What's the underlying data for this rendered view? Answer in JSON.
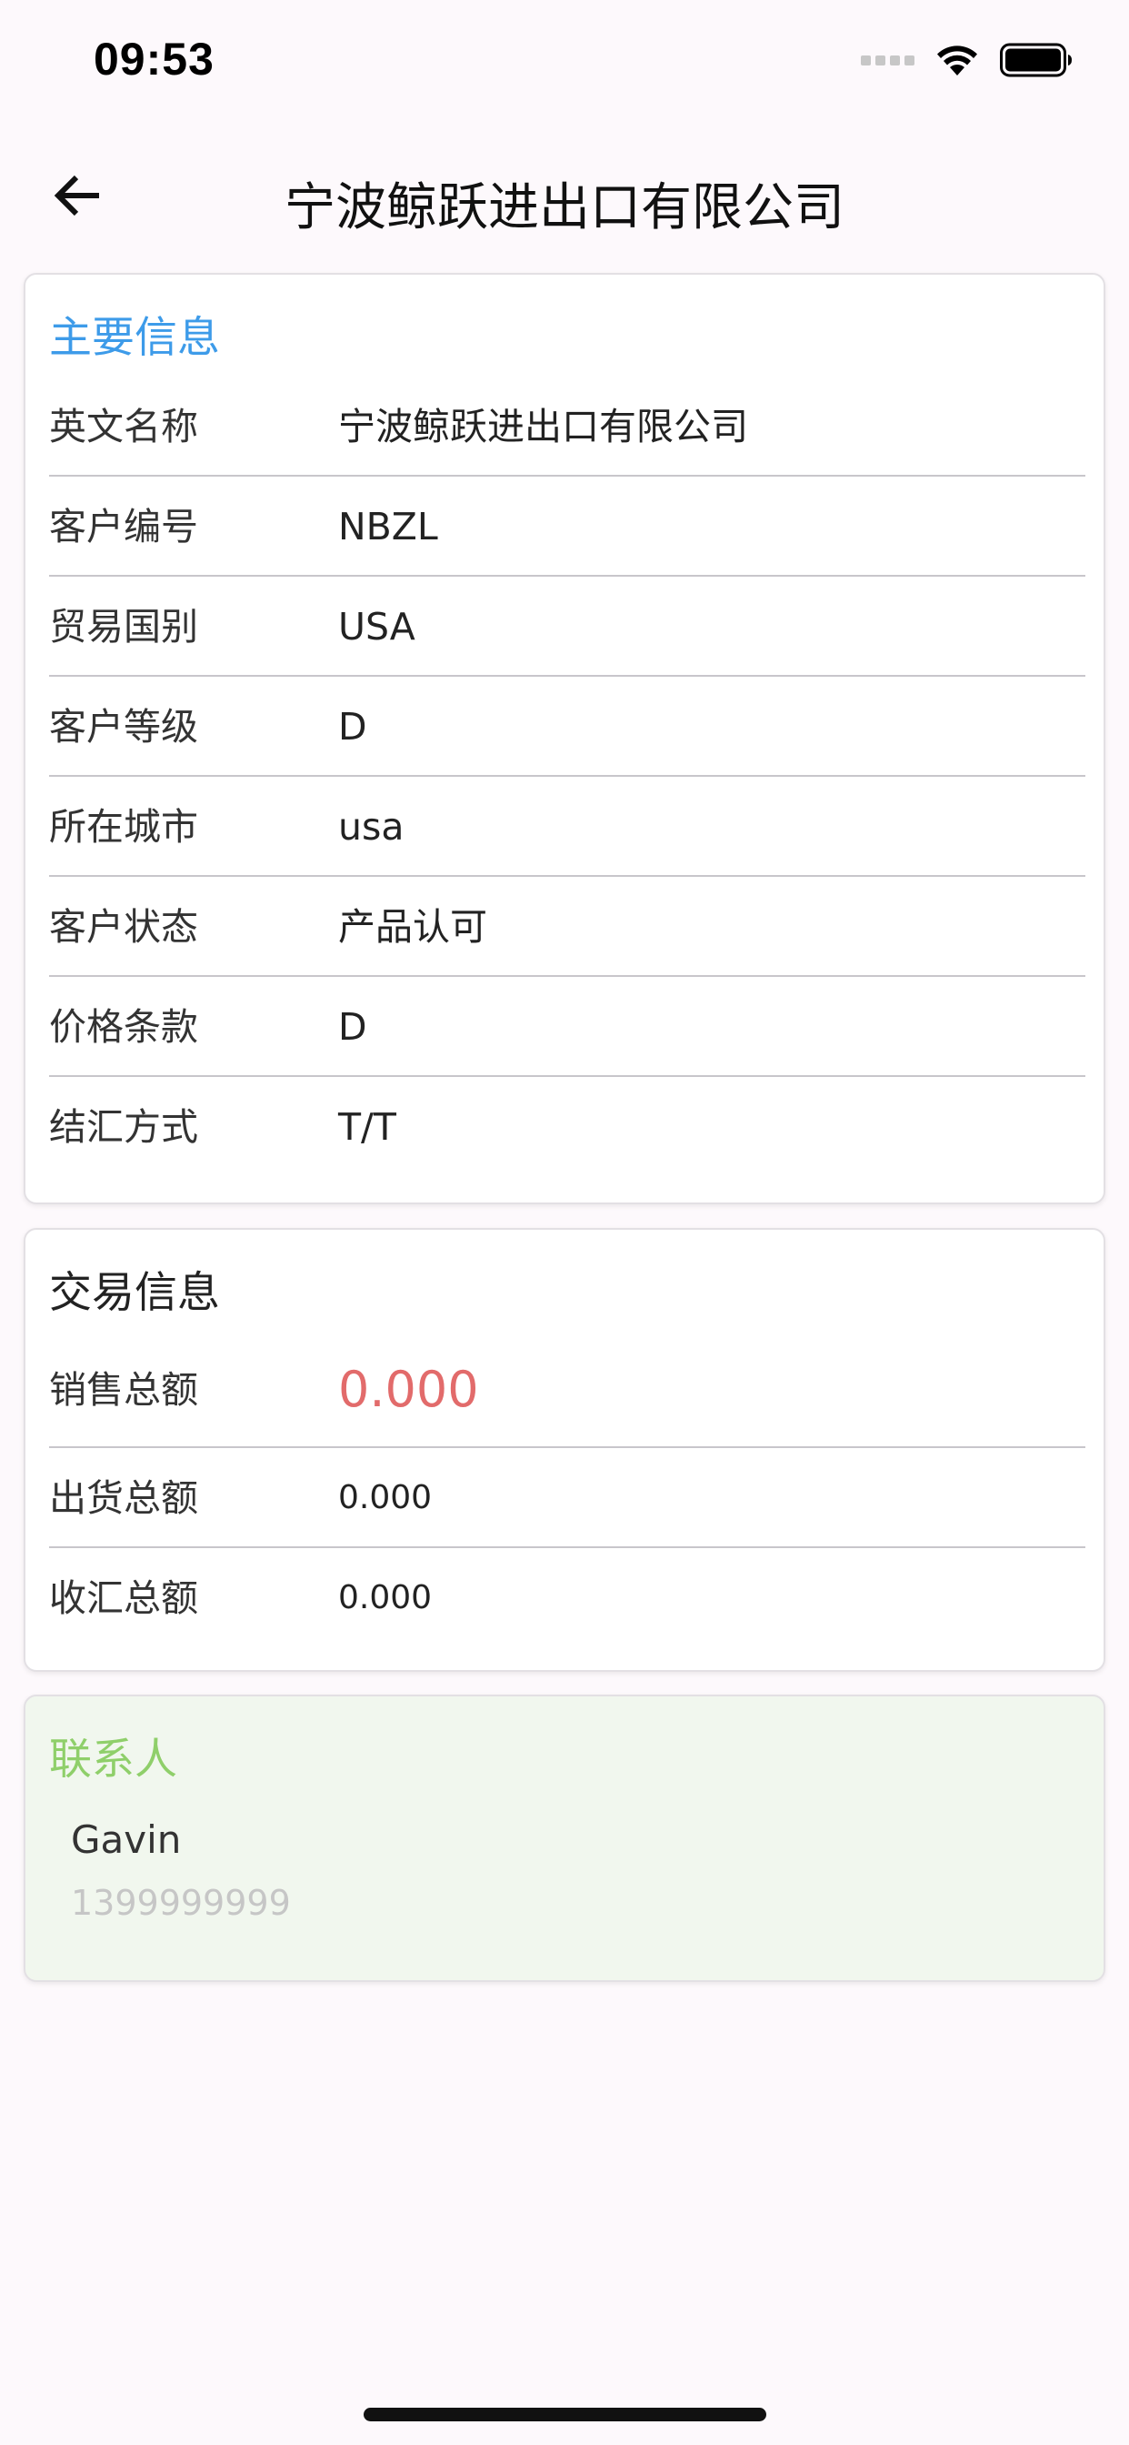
{
  "status_bar": {
    "time": "09:53"
  },
  "header": {
    "title": "宁波鲸跃进出口有限公司",
    "back_icon": "arrow-left-icon"
  },
  "main_info": {
    "title": "主要信息",
    "title_color": "#3d9be9",
    "rows": [
      {
        "label": "英文名称",
        "value": "宁波鲸跃进出口有限公司"
      },
      {
        "label": "客户编号",
        "value": "NBZL"
      },
      {
        "label": "贸易国别",
        "value": "USA"
      },
      {
        "label": "客户等级",
        "value": "D"
      },
      {
        "label": "所在城市",
        "value": "usa"
      },
      {
        "label": "客户状态",
        "value": "产品认可"
      },
      {
        "label": "价格条款",
        "value": "D"
      },
      {
        "label": "结汇方式",
        "value": "T/T"
      }
    ]
  },
  "trade_info": {
    "title": "交易信息",
    "amount_color": "#e26b6b",
    "rows": [
      {
        "label": "销售总额",
        "value": "0.000"
      },
      {
        "label": "出货总额",
        "value": "0.000"
      },
      {
        "label": "收汇总额",
        "value": "0.000"
      }
    ]
  },
  "contacts": {
    "title": "联系人",
    "title_color": "#8fcf6a",
    "background": "#f1f7ee",
    "items": [
      {
        "name": "Gavin",
        "phone": "1399999999"
      }
    ]
  }
}
